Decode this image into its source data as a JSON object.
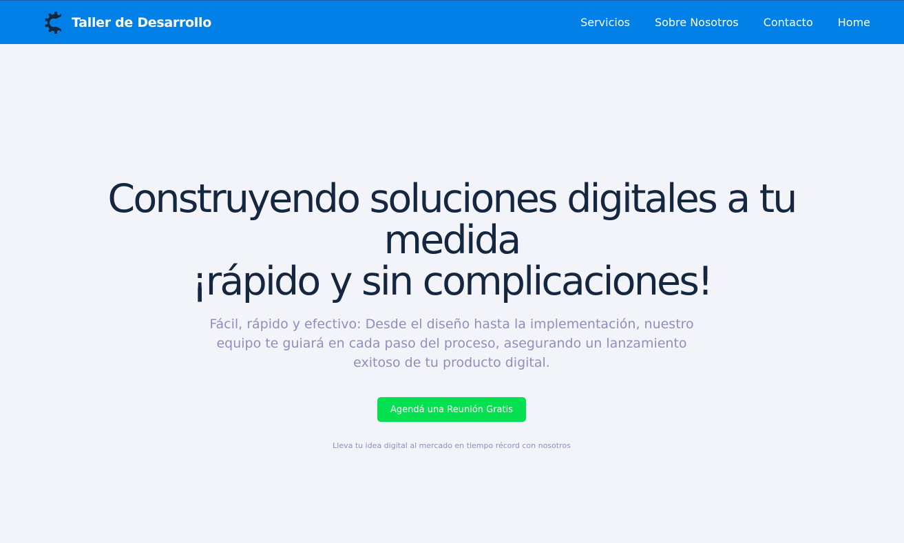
{
  "brand": {
    "name": "Taller de Desarrollo",
    "icon": "gear-icon"
  },
  "nav": {
    "items": [
      {
        "label": "Servicios"
      },
      {
        "label": "Sobre Nosotros"
      },
      {
        "label": "Contacto"
      },
      {
        "label": "Home"
      }
    ]
  },
  "hero": {
    "title_lines": [
      "Construyendo soluciones digitales a tu",
      "medida",
      "¡rápido y sin complicaciones!"
    ],
    "subtitle": "Fácil, rápido y efectivo: Desde el diseño hasta la implementación, nuestro equipo te guiará en cada paso del proceso, asegurando un lanzamiento exitoso de tu producto digital.",
    "cta_label": "Agendá una Reunión Gratis",
    "tagline": "Lleva tu idea digital al mercado en tiempo récord con nosotros"
  },
  "colors": {
    "header": "#0080e6",
    "background": "#f2f4fa",
    "title": "#15273f",
    "muted": "#8c8fc0",
    "cta": "#05e050"
  }
}
